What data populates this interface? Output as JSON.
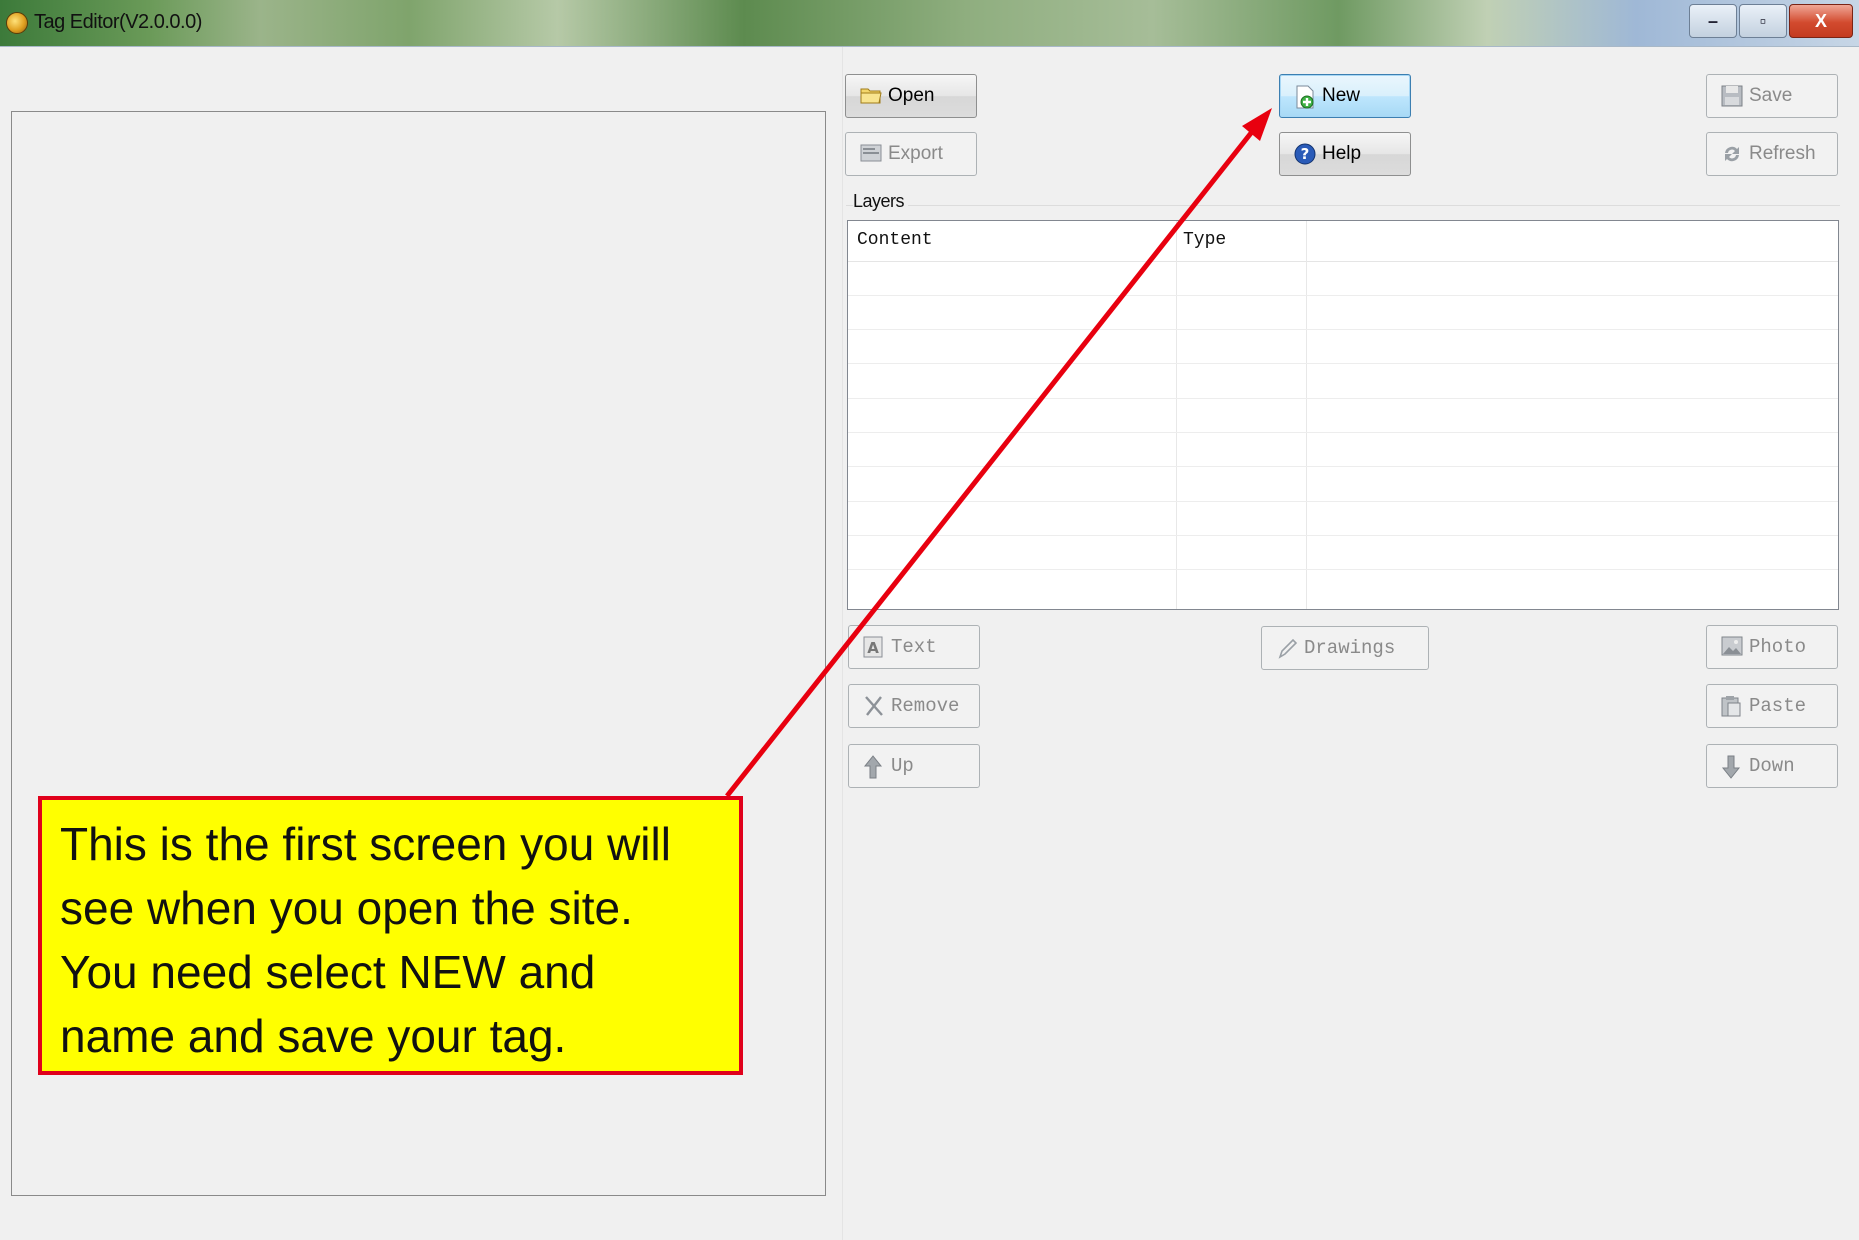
{
  "window": {
    "title": "Tag Editor(V2.0.0.0)",
    "minimize_glyph": "–",
    "maximize_glyph": "▫",
    "close_glyph": "X"
  },
  "toolbar": {
    "open": "Open",
    "new": "New",
    "save": "Save",
    "export": "Export",
    "help": "Help",
    "refresh": "Refresh"
  },
  "layers": {
    "label": "Layers",
    "columns": [
      "Content",
      "Type"
    ]
  },
  "layer_actions": {
    "text": "Text",
    "drawings": "Drawings",
    "photo": "Photo",
    "remove": "Remove",
    "paste": "Paste",
    "up": "Up",
    "down": "Down"
  },
  "annotation": {
    "lines": [
      "This is the first screen you will",
      "see when you open the site.",
      "You need select NEW and",
      "name and save your tag."
    ],
    "box_color": "#ffff00",
    "border_color": "#e0001b"
  }
}
